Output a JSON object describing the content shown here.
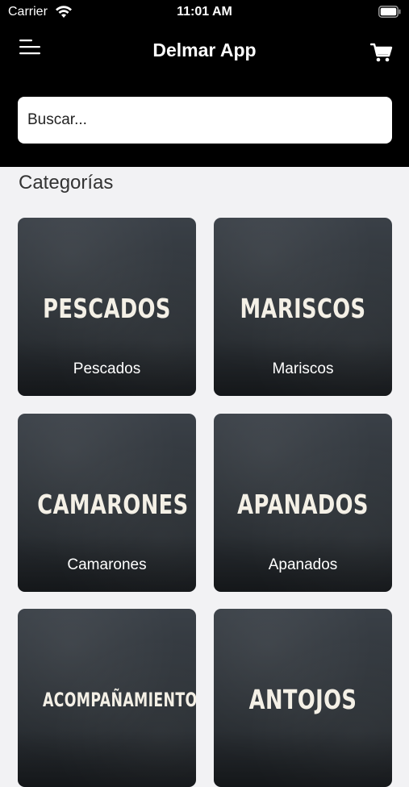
{
  "status_bar": {
    "carrier": "Carrier",
    "time": "11:01 AM"
  },
  "header": {
    "title": "Delmar App"
  },
  "search": {
    "placeholder": "Buscar..."
  },
  "section": {
    "title": "Categorías"
  },
  "categories": [
    {
      "image_text": "PESCADOS",
      "label": "Pescados"
    },
    {
      "image_text": "MARISCOS",
      "label": "Mariscos"
    },
    {
      "image_text": "CAMARONES",
      "label": "Camarones"
    },
    {
      "image_text": "APANADOS",
      "label": "Apanados"
    },
    {
      "image_text": "ACOMPAÑAMIENTOS",
      "label": ""
    },
    {
      "image_text": "ANTOJOS",
      "label": ""
    }
  ],
  "colors": {
    "header_bg": "#000000",
    "card_bg": "#2f3439",
    "page_bg": "#f2f2f4"
  },
  "icons": [
    "wifi-icon",
    "battery-icon",
    "menu-icon",
    "cart-icon"
  ]
}
